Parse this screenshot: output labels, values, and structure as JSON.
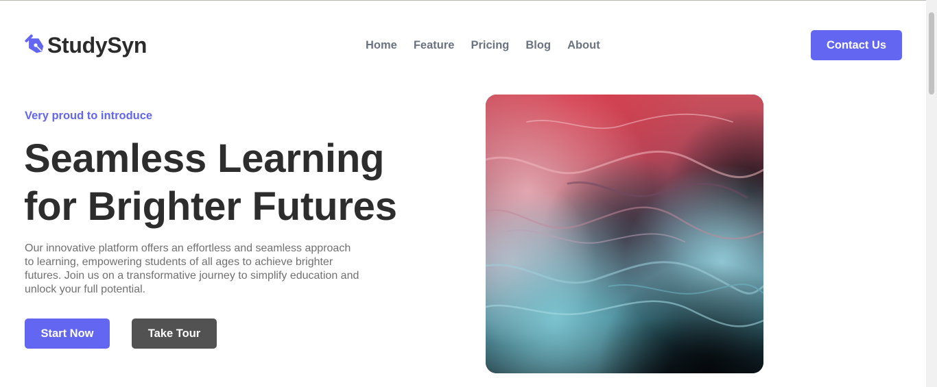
{
  "brand": {
    "name": "StudySyn",
    "logo_icon": "pen-nib-icon",
    "accent_color": "#6366f1"
  },
  "nav": {
    "links": [
      "Home",
      "Feature",
      "Pricing",
      "Blog",
      "About"
    ]
  },
  "header": {
    "contact_label": "Contact Us"
  },
  "hero": {
    "eyebrow": "Very proud to introduce",
    "title_line1": "Seamless Learning",
    "title_line2": "for Brighter Futures",
    "description": "Our innovative platform offers an effortless and seamless approach to learning, empowering students of all ages to achieve brighter futures. Join us on a transformative journey to simplify education and unlock your full potential.",
    "primary_cta": "Start Now",
    "secondary_cta": "Take Tour"
  },
  "colors": {
    "primary": "#6366f1",
    "secondary_button": "#525252",
    "heading": "#2d2d2d",
    "nav_text": "#6b7282",
    "body_text": "#707070"
  }
}
